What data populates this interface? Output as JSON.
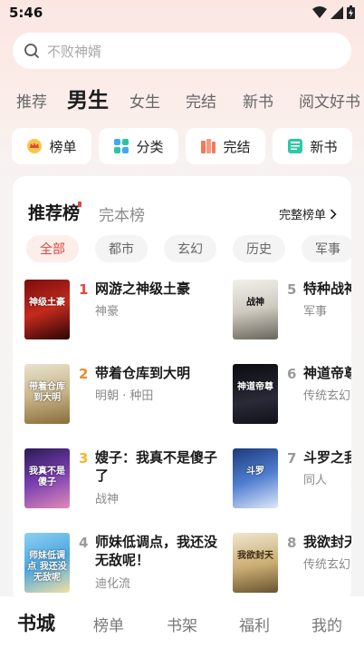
{
  "status": {
    "time": "5:46"
  },
  "search": {
    "placeholder": "不败神婿"
  },
  "top_tabs": [
    "推荐",
    "男生",
    "女生",
    "完结",
    "新书",
    "阅文好书"
  ],
  "active_top_tab": "男生",
  "quick_buttons": [
    {
      "label": "榜单",
      "icon": "crown-badge-icon"
    },
    {
      "label": "分类",
      "icon": "grid-squares-icon"
    },
    {
      "label": "完结",
      "icon": "books-icon"
    },
    {
      "label": "新书",
      "icon": "new-book-icon"
    }
  ],
  "ranking": {
    "title": "推荐榜",
    "subtitle": "完本榜",
    "view_all": "完整榜单",
    "categories": [
      "全部",
      "都市",
      "玄幻",
      "历史",
      "军事"
    ],
    "active_category": "全部",
    "books": [
      {
        "rank": "1",
        "title": "网游之神级土豪",
        "tag": "神豪",
        "cover_text": "神级土豪",
        "rank_color": "#e5443d"
      },
      {
        "rank": "2",
        "title": "带着仓库到大明",
        "tag": "明朝 · 种田",
        "cover_text": "带着仓库到大明",
        "rank_color": "#f08a2c"
      },
      {
        "rank": "3",
        "title": "嫂子：我真不是傻子了",
        "tag": "战神",
        "cover_text": "我真不是傻子",
        "rank_color": "#f2b632"
      },
      {
        "rank": "4",
        "title": "师妹低调点，我还没无敌呢！",
        "tag": "迪化流",
        "cover_text": "师妹低调点 我还没无敌呢",
        "rank_color": "#9a9a9a"
      },
      {
        "rank": "5",
        "title": "特种战神",
        "tag": "军事",
        "cover_text": "战神",
        "rank_color": "#9a9a9a"
      },
      {
        "rank": "6",
        "title": "神道帝尊",
        "tag": "传统玄幻",
        "cover_text": "神道帝尊",
        "rank_color": "#9a9a9a"
      },
      {
        "rank": "7",
        "title": "斗罗之我",
        "tag": "同人",
        "cover_text": "斗罗",
        "rank_color": "#9a9a9a"
      },
      {
        "rank": "8",
        "title": "我欲封天",
        "tag": "传统玄幻",
        "cover_text": "我欲封天",
        "rank_color": "#9a9a9a"
      }
    ]
  },
  "bottom_nav": [
    "书城",
    "榜单",
    "书架",
    "福利",
    "我的"
  ],
  "active_bottom_nav": "书城",
  "colors": {
    "accent": "#e5443d",
    "background_top": "#fbe6e2"
  }
}
